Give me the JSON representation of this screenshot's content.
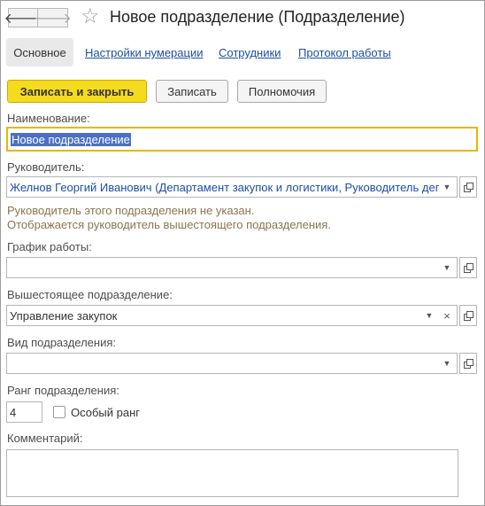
{
  "header": {
    "back_icon": "arrow-left-icon",
    "forward_icon": "arrow-right-icon",
    "star_icon": "star-outline-icon",
    "back_glyph": "🡐",
    "forward_glyph": "🡒",
    "star_glyph": "☆",
    "title": "Новое подразделение (Подразделение)"
  },
  "tabs": [
    {
      "label": "Основное"
    },
    {
      "label": "Настройки нумерации"
    },
    {
      "label": "Сотрудники"
    },
    {
      "label": "Протокол работы"
    }
  ],
  "toolbar": {
    "save_close": "Записать и закрыть",
    "save": "Записать",
    "permissions": "Полномочия"
  },
  "form": {
    "name_label": "Наименование:",
    "name_value": "Новое подразделение",
    "head_label": "Руководитель:",
    "head_value": "Желнов Георгий Иванович (Департамент закупок и логистики, Руководитель деп",
    "hint_line1": "Руководитель этого подразделения не указан.",
    "hint_line2": "Отображается руководитель вышестоящего подразделения.",
    "schedule_label": "График работы:",
    "schedule_value": "",
    "parent_label": "Вышестоящее подразделение:",
    "parent_value": "Управление закупок",
    "type_label": "Вид подразделения:",
    "type_value": "",
    "rank_label": "Ранг подразделения:",
    "rank_value": "4",
    "special_rank_label": "Особый ранг",
    "special_rank_checked": false,
    "comment_label": "Комментарий:",
    "comment_value": ""
  },
  "glyphs": {
    "dropdown": "▼",
    "clear": "×"
  },
  "colors": {
    "accent_yellow": "#f5db1f",
    "focus_border": "#e6b800",
    "selection": "#4b6fc4",
    "link": "#1c4fa3",
    "hint": "#8a7550"
  }
}
